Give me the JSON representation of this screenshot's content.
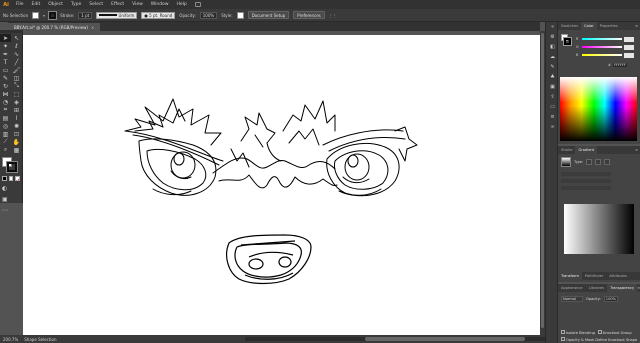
{
  "app": {
    "logo": "Ai",
    "menu": [
      "File",
      "Edit",
      "Object",
      "Type",
      "Select",
      "Effect",
      "View",
      "Window",
      "Help"
    ]
  },
  "controlbar": {
    "selection_status": "No Selection",
    "stroke_label": "Stroke:",
    "stroke_weight": "1 pt",
    "profile_label": "Uniform",
    "brush_label": "5 pt. Round",
    "opacity_label": "Opacity:",
    "opacity_value": "100%",
    "style_label": "Style:",
    "document_setup": "Document Setup",
    "preferences": "Preferences"
  },
  "document": {
    "tab_title": "BBY.Art.ai* @ 200.7 % (RGB/Preview)",
    "zoom": "200.7%",
    "status_text": "Shape Selection"
  },
  "panels": {
    "color": {
      "tabs": [
        "Swatches",
        "Color",
        "Properties"
      ],
      "active": "Color",
      "hex": "FFFFFF"
    },
    "gradient": {
      "tabs": [
        "Stroke",
        "Gradient"
      ],
      "active": "Gradient",
      "type_label": "Type:"
    },
    "transparency": {
      "tabs": [
        "Appearance",
        "Libraries",
        "Transparency"
      ],
      "active": "Transparency",
      "blend_mode": "Normal",
      "opacity_label": "Opacity:",
      "opacity_value": "100%",
      "isolate_blending": "Isolate Blending",
      "knockout_group": "Knockout Group",
      "opacity_mask_label": "Opacity & Mask Define Knockout Shape"
    },
    "transform_tabs": [
      "Transform",
      "Pathfinder",
      "Attributes"
    ]
  }
}
